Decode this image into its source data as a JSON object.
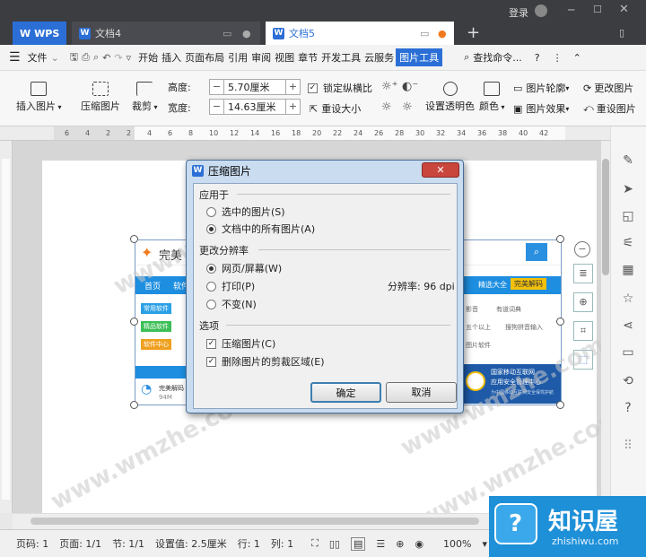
{
  "titlebar": {
    "login": "登录",
    "tabs": [
      {
        "label": "WPS"
      },
      {
        "label": "文档4"
      },
      {
        "label": "文档5"
      }
    ],
    "add": "+"
  },
  "menu": {
    "file": "文件",
    "items": [
      "开始",
      "插入",
      "页面布局",
      "引用",
      "审阅",
      "视图",
      "章节",
      "开发工具",
      "云服务",
      "图片工具"
    ],
    "search": "查找命令..."
  },
  "ribbon": {
    "insert_pic": "插入图片",
    "compress": "压缩图片",
    "crop": "裁剪",
    "height_label": "高度:",
    "height_value": "5.70厘米",
    "width_label": "宽度:",
    "width_value": "14.63厘米",
    "lock_ratio": "锁定纵横比",
    "reset_size": "重设大小",
    "transparent": "设置透明色",
    "color": "颜色",
    "outline": "图片轮廓",
    "effect": "图片效果",
    "change": "更改图片",
    "reset_pic": "重设图片"
  },
  "ruler": {
    "ticks": [
      "6",
      "4",
      "2",
      "2",
      "4",
      "6",
      "8",
      "10",
      "12",
      "14",
      "16",
      "18",
      "20",
      "22",
      "24",
      "26",
      "28",
      "30",
      "32",
      "34",
      "36",
      "38",
      "40",
      "42"
    ]
  },
  "dialog": {
    "title": "压缩图片",
    "apply_section": "应用于",
    "apply_selected": "选中的图片(S)",
    "apply_all": "文档中的所有图片(A)",
    "resolution_section": "更改分辨率",
    "res_web": "网页/屏幕(W)",
    "res_print": "打印(P)",
    "res_none": "不变(N)",
    "dpi_label": "分辨率: 96 dpi",
    "options_section": "选项",
    "opt_compress": "压缩图片(C)",
    "opt_delete_crop": "删除图片的剪裁区域(E)",
    "ok": "确定",
    "cancel": "取消"
  },
  "embedded": {
    "logo": "完美",
    "nav": [
      "首页",
      "软件"
    ],
    "tab_links": [
      "精选大全",
      "完美解码"
    ],
    "side_items": [
      "常用软件",
      "精品软件",
      "软件中心"
    ],
    "links": [
      "影音",
      "有道词典",
      "五个以上",
      "搜狗拼音输入",
      "图片软件"
    ],
    "banner_title": "国家移动互联网",
    "banner_sub": "应用安全管理中心",
    "banner_small": "为中国移动互联网安全保驾护航",
    "decode_label": "完美解码",
    "size": "94M"
  },
  "watermark": "www.wmzhe.com",
  "status": {
    "page": "页码: 1",
    "pages": "页面: 1/1",
    "section": "节: 1/1",
    "setting": "设置值: 2.5厘米",
    "row": "行: 1",
    "col": "列: 1",
    "zoom": "100%"
  },
  "brand": {
    "name": "知识屋",
    "domain": "zhishiwu.com"
  },
  "colors": {
    "accent": "#2b6fd6",
    "titlebar": "#3c3d41",
    "active_tab_dot": "#f07a1e",
    "brand": "#1e90d8"
  }
}
